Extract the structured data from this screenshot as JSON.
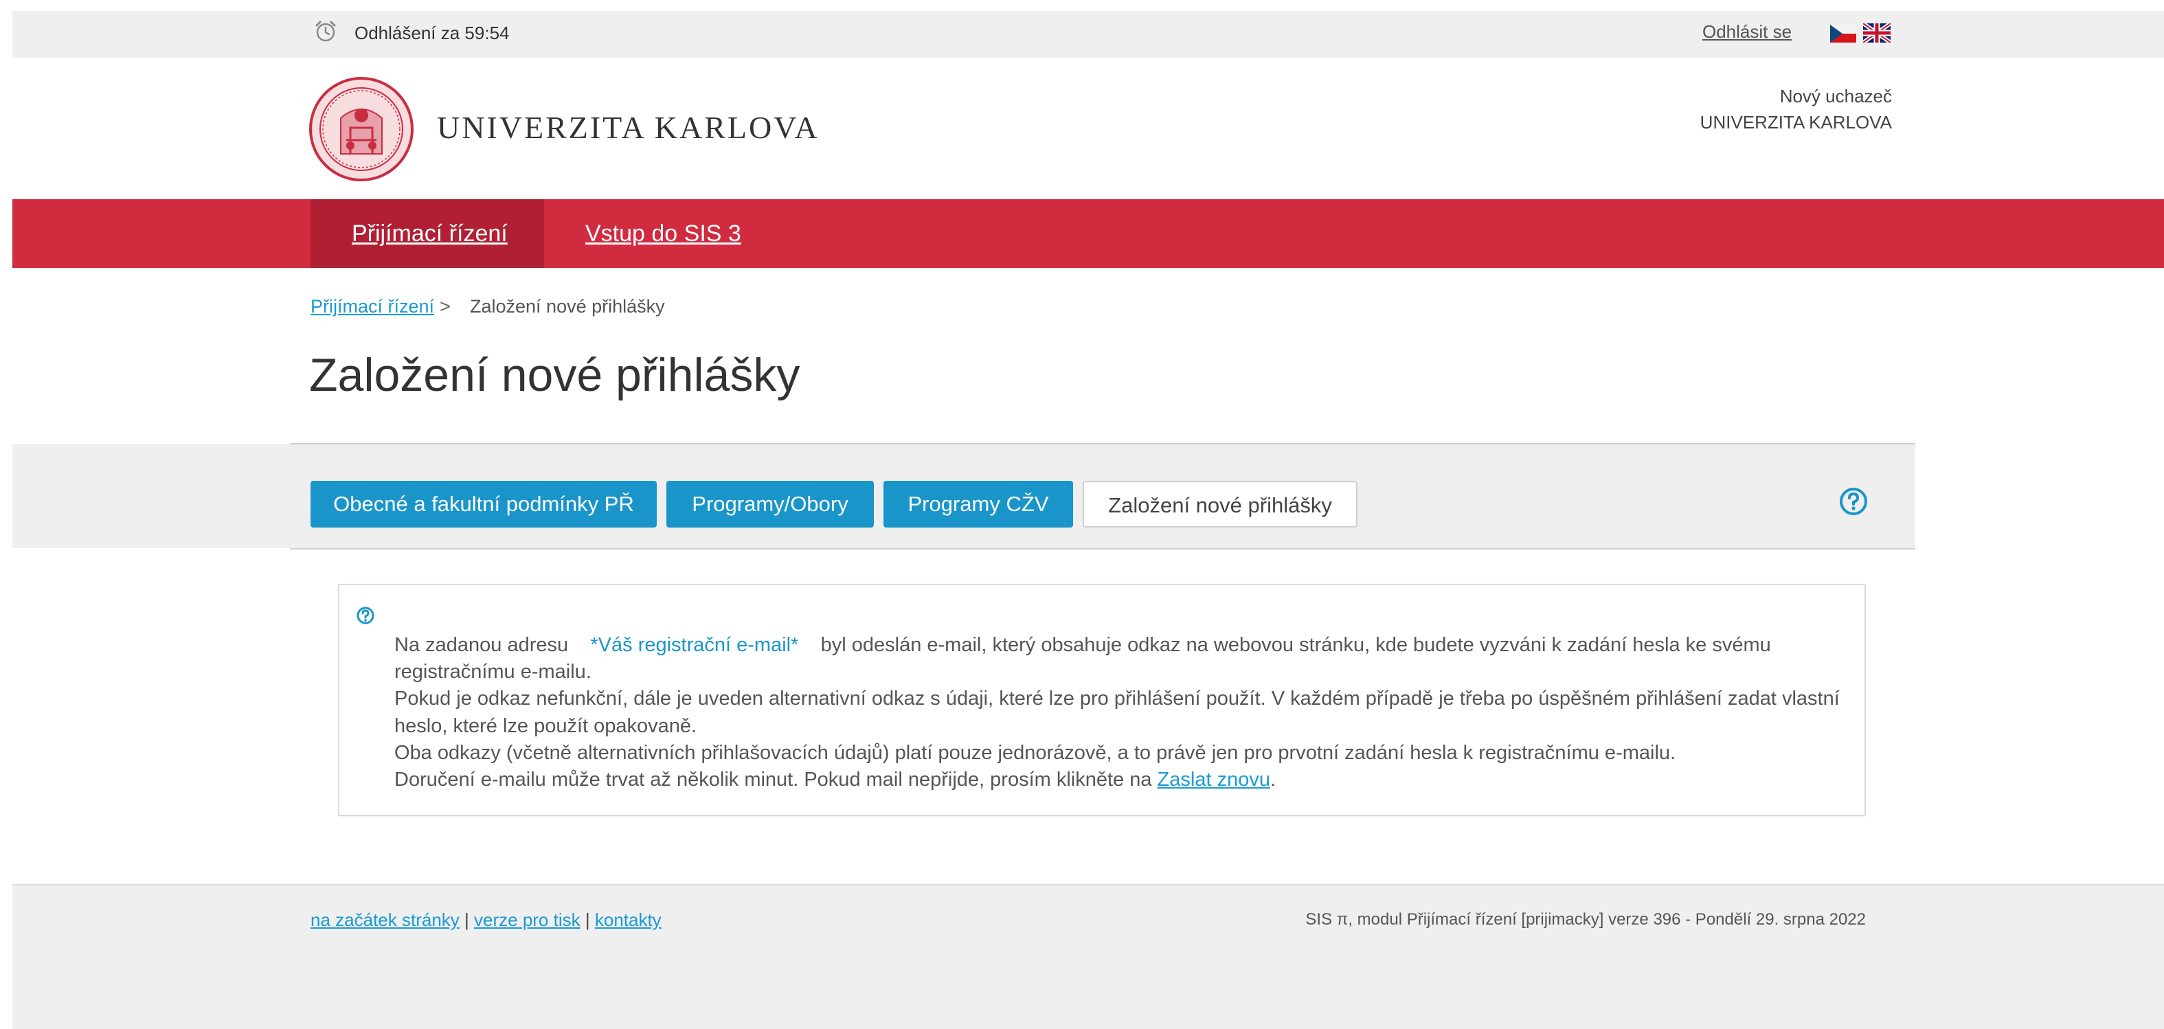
{
  "topbar": {
    "timer_icon": "alarm-clock-icon",
    "logout_timer": "Odhlášení za 59:54",
    "logout_label": "Odhlásit se",
    "languages": [
      "cz-flag-icon",
      "en-flag-icon"
    ]
  },
  "header": {
    "brand": "UNIVERZITA KARLOVA",
    "user_role": "Nový uchazeč",
    "user_org": "UNIVERZITA KARLOVA"
  },
  "nav": {
    "items": [
      {
        "label": "Přijímací řízení",
        "active": true
      },
      {
        "label": "Vstup do SIS 3",
        "active": false
      }
    ],
    "color": "#d12b3f",
    "active_color": "#b01f33"
  },
  "breadcrumb": {
    "root": "Přijímací řízení",
    "separator": ">",
    "current": "Založení nové přihlášky"
  },
  "page_title": "Založení nové přihlášky",
  "tabs": [
    {
      "label": "Obecné a fakultní podmínky PŘ",
      "active": false
    },
    {
      "label": "Programy/Obory",
      "active": false
    },
    {
      "label": "Programy CŽV",
      "active": false
    },
    {
      "label": "Založení nové přihlášky",
      "active": true
    }
  ],
  "message": {
    "line1_prefix": "Na zadanou adresu",
    "email_placeholder": "*Váš registrační e-mail*",
    "line1_suffix": "byl odeslán e-mail, který obsahuje odkaz na webovou stránku, kde budete vyzváni k zadání hesla ke svému registračnímu e-mailu.",
    "line2": "Pokud je odkaz nefunkční, dále je uveden alternativní odkaz s údaji, které lze pro přihlášení použít. V každém případě je třeba po úspěšném přihlášení zadat vlastní heslo, které lze použít opakovaně.",
    "line3": "Oba odkazy (včetně alternativních přihlašovacích údajů) platí pouze jednorázově, a to právě jen pro prvotní zadání hesla k registračnímu e-mailu.",
    "line4_prefix": "Doručení e-mailu může trvat až několik minut. Pokud mail nepřijde, prosím klikněte na",
    "resend_link": "Zaslat znovu",
    "line4_suffix": "."
  },
  "footer": {
    "links": [
      "na začátek stránky",
      "verze pro tisk",
      "kontakty"
    ],
    "separator": "|",
    "version": "SIS π, modul Přijímací řízení [prijimacky] verze 396 - Pondělí 29. srpna 2022"
  },
  "colors": {
    "accent_blue": "#1a95ca",
    "brand_red": "#d12b3f",
    "band_gray": "#efefef"
  }
}
